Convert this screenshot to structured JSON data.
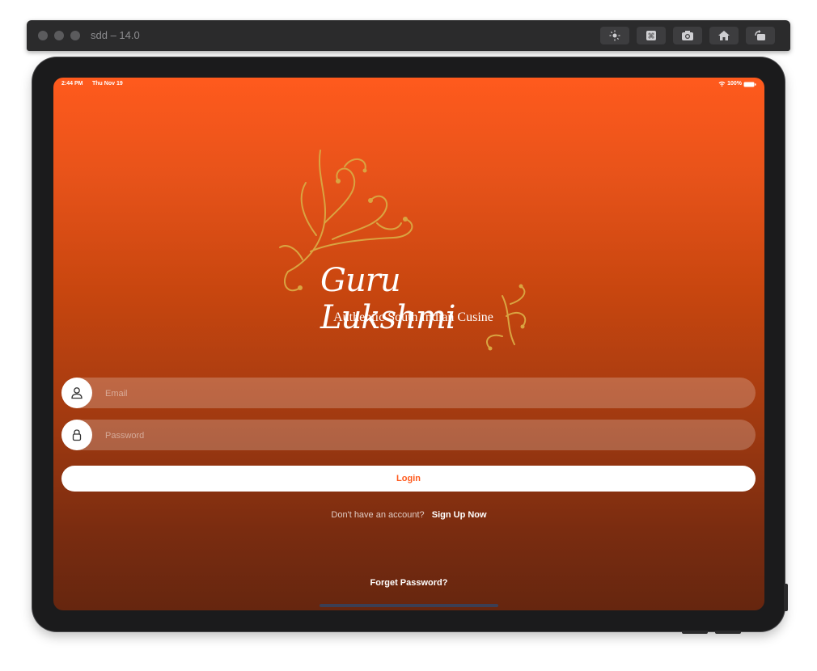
{
  "simulator": {
    "title": "sdd – 14.0",
    "tools": [
      "brightness-icon",
      "command-icon",
      "screenshot-icon",
      "home-icon",
      "rotate-icon"
    ]
  },
  "status_bar": {
    "time": "2:44 PM",
    "date": "Thu Nov 19",
    "battery": "100%"
  },
  "brand": {
    "name": "Guru Lukshmi",
    "tagline": "Authentic South Indian Cusine"
  },
  "form": {
    "email_placeholder": "Email",
    "password_placeholder": "Password",
    "login_label": "Login"
  },
  "signup": {
    "prompt": "Don't have an account?",
    "link": "Sign Up Now"
  },
  "forget_password": "Forget Password?",
  "colors": {
    "accent": "#ff5a1d",
    "gold": "#d9a441",
    "frame": "#1b1b1c"
  }
}
